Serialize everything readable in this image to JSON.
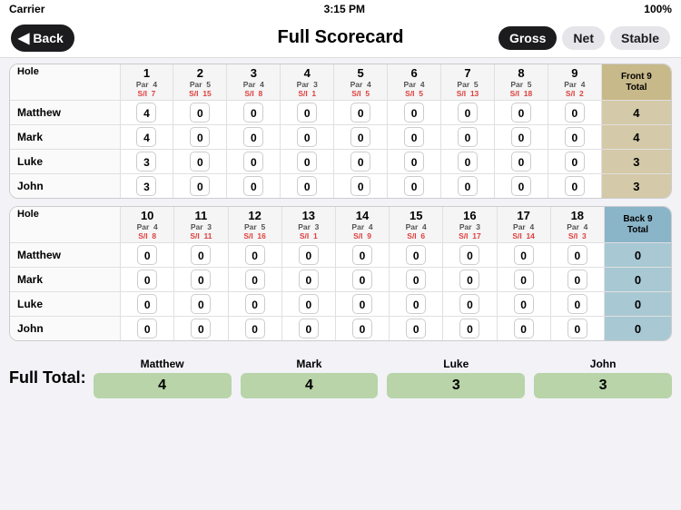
{
  "status": {
    "carrier": "Carrier",
    "time": "3:15 PM",
    "battery": "100%"
  },
  "header": {
    "back_label": "Back",
    "title": "Full Scorecard",
    "btn_gross": "Gross",
    "btn_net": "Net",
    "btn_stable": "Stable"
  },
  "front9": {
    "section_label": "Front 9",
    "holes": [
      {
        "num": "1",
        "par": "Par",
        "par_val": "4",
        "si": "S/I",
        "si_val": "7"
      },
      {
        "num": "2",
        "par": "Par",
        "par_val": "5",
        "si": "S/I",
        "si_val": "15"
      },
      {
        "num": "3",
        "par": "Par",
        "par_val": "4",
        "si": "S/I",
        "si_val": "8"
      },
      {
        "num": "4",
        "par": "Par",
        "par_val": "3",
        "si": "S/I",
        "si_val": "1"
      },
      {
        "num": "5",
        "par": "Par",
        "par_val": "4",
        "si": "S/I",
        "si_val": "5"
      },
      {
        "num": "6",
        "par": "Par",
        "par_val": "4",
        "si": "S/I",
        "si_val": "5"
      },
      {
        "num": "7",
        "par": "Par",
        "par_val": "5",
        "si": "S/I",
        "si_val": "13"
      },
      {
        "num": "8",
        "par": "Par",
        "par_val": "5",
        "si": "S/I",
        "si_val": "18"
      },
      {
        "num": "9",
        "par": "Par",
        "par_val": "4",
        "si": "S/I",
        "si_val": "2"
      }
    ],
    "total_label": "Front 9\nTotal",
    "players": [
      {
        "name": "Matthew",
        "scores": [
          4,
          0,
          0,
          0,
          0,
          0,
          0,
          0,
          0
        ],
        "total": "4"
      },
      {
        "name": "Mark",
        "scores": [
          4,
          0,
          0,
          0,
          0,
          0,
          0,
          0,
          0
        ],
        "total": "4"
      },
      {
        "name": "Luke",
        "scores": [
          3,
          0,
          0,
          0,
          0,
          0,
          0,
          0,
          0
        ],
        "total": "3"
      },
      {
        "name": "John",
        "scores": [
          3,
          0,
          0,
          0,
          0,
          0,
          0,
          0,
          0
        ],
        "total": "3"
      }
    ]
  },
  "back9": {
    "section_label": "Back 9",
    "holes": [
      {
        "num": "10",
        "par": "Par",
        "par_val": "4",
        "si": "S/I",
        "si_val": "8"
      },
      {
        "num": "11",
        "par": "Par",
        "par_val": "3",
        "si": "S/I",
        "si_val": "11"
      },
      {
        "num": "12",
        "par": "Par",
        "par_val": "5",
        "si": "S/I",
        "si_val": "16"
      },
      {
        "num": "13",
        "par": "Par",
        "par_val": "3",
        "si": "S/I",
        "si_val": "1"
      },
      {
        "num": "14",
        "par": "Par",
        "par_val": "4",
        "si": "S/I",
        "si_val": "9"
      },
      {
        "num": "15",
        "par": "Par",
        "par_val": "4",
        "si": "S/I",
        "si_val": "6"
      },
      {
        "num": "16",
        "par": "Par",
        "par_val": "3",
        "si": "S/I",
        "si_val": "17"
      },
      {
        "num": "17",
        "par": "Par",
        "par_val": "4",
        "si": "S/I",
        "si_val": "14"
      },
      {
        "num": "18",
        "par": "Par",
        "par_val": "4",
        "si": "S/I",
        "si_val": "3"
      }
    ],
    "total_label": "Back 9\nTotal",
    "players": [
      {
        "name": "Matthew",
        "scores": [
          0,
          0,
          0,
          0,
          0,
          0,
          0,
          0,
          0
        ],
        "total": "0"
      },
      {
        "name": "Mark",
        "scores": [
          0,
          0,
          0,
          0,
          0,
          0,
          0,
          0,
          0
        ],
        "total": "0"
      },
      {
        "name": "Luke",
        "scores": [
          0,
          0,
          0,
          0,
          0,
          0,
          0,
          0,
          0
        ],
        "total": "0"
      },
      {
        "name": "John",
        "scores": [
          0,
          0,
          0,
          0,
          0,
          0,
          0,
          0,
          0
        ],
        "total": "0"
      }
    ]
  },
  "full_total": {
    "label": "Full Total:",
    "players": [
      {
        "name": "Matthew",
        "total": "4"
      },
      {
        "name": "Mark",
        "total": "4"
      },
      {
        "name": "Luke",
        "total": "3"
      },
      {
        "name": "John",
        "total": "3"
      }
    ]
  }
}
